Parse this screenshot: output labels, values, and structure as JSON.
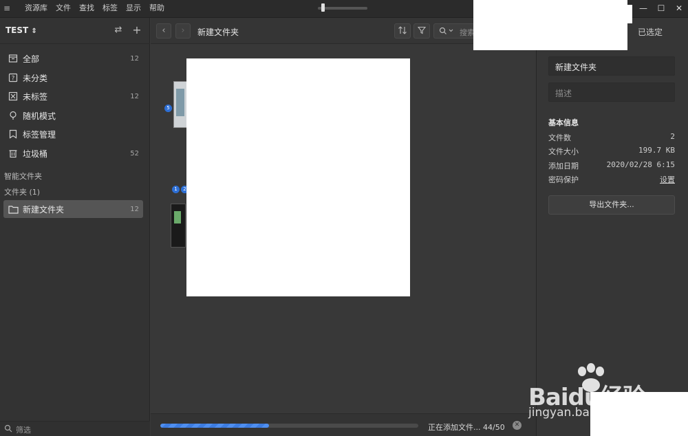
{
  "menu": {
    "items": [
      "资源库",
      "文件",
      "查找",
      "标签",
      "显示",
      "帮助"
    ]
  },
  "window": {
    "zoom_level": 0.1
  },
  "sidebar": {
    "library_name": "TEST",
    "items": [
      {
        "label": "全部",
        "count": "12",
        "icon": "archive-icon"
      },
      {
        "label": "未分类",
        "count": "",
        "icon": "question-box-icon"
      },
      {
        "label": "未标签",
        "count": "12",
        "icon": "untagged-icon"
      },
      {
        "label": "随机模式",
        "count": "",
        "icon": "bulb-icon"
      },
      {
        "label": "标签管理",
        "count": "",
        "icon": "bookmark-icon"
      },
      {
        "label": "垃圾桶",
        "count": "52",
        "icon": "trash-icon"
      }
    ],
    "smart_folders_title": "智能文件夹",
    "folders_title": "文件夹 (1)",
    "folders": [
      {
        "label": "新建文件夹",
        "count": "12"
      }
    ],
    "filter_label": "筛选"
  },
  "toolbar": {
    "folder_title": "新建文件夹",
    "search_placeholder": "搜索"
  },
  "content": {
    "thumb_badges": [
      "5",
      "1",
      "2"
    ]
  },
  "panel": {
    "header_label": "已选定",
    "name_value": "新建文件夹",
    "description_placeholder": "描述",
    "info_title": "基本信息",
    "info": [
      {
        "key": "文件数",
        "value": "2"
      },
      {
        "key": "文件大小",
        "value": "199.7 KB"
      },
      {
        "key": "添加日期",
        "value": "2020/02/28 6:15"
      },
      {
        "key": "密码保护",
        "value": "设置"
      }
    ],
    "export_label": "导出文件夹..."
  },
  "status": {
    "progress_fraction": 0.42,
    "text": "正在添加文件... 44/50"
  },
  "watermark": {
    "brand": "Baidu经验",
    "url": "jingyan.baidu.com"
  },
  "colors": {
    "accent": "#3d7ce0",
    "badge": "#2d6fd6"
  }
}
